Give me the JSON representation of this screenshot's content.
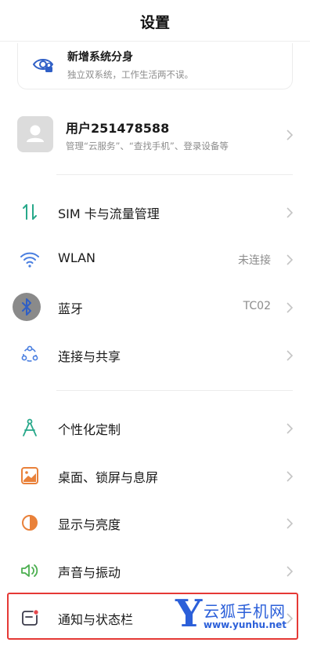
{
  "header": {
    "title": "设置"
  },
  "promo": {
    "title": "新增系统分身",
    "subtitle": "独立双系统，工作生活两不误。",
    "icon": "eye-lock-icon"
  },
  "account": {
    "name": "用户251478588",
    "description": "管理“云服务”、“查找手机”、登录设备等"
  },
  "settings": {
    "group1": [
      {
        "label": "SIM 卡与流量管理",
        "value": "",
        "icon": "sim-data-icon",
        "color": "#27a88a"
      },
      {
        "label": "WLAN",
        "value": "未连接",
        "icon": "wifi-icon",
        "color": "#4a7fe0"
      },
      {
        "label": "蓝牙",
        "value": "TC02",
        "icon": "bluetooth-icon",
        "color": "#3f68c8"
      },
      {
        "label": "连接与共享",
        "value": "",
        "icon": "connection-share-icon",
        "color": "#4a7fe0"
      }
    ],
    "group2": [
      {
        "label": "个性化定制",
        "value": "",
        "icon": "personalize-icon",
        "color": "#27a88a"
      },
      {
        "label": "桌面、锁屏与息屏",
        "value": "",
        "icon": "wallpaper-icon",
        "color": "#e9813a"
      },
      {
        "label": "显示与亮度",
        "value": "",
        "icon": "display-brightness-icon",
        "color": "#e9813a"
      },
      {
        "label": "声音与振动",
        "value": "",
        "icon": "sound-vibration-icon",
        "color": "#4caf50"
      },
      {
        "label": "通知与状态栏",
        "value": "",
        "icon": "notification-icon",
        "color": "#e5484d"
      }
    ]
  },
  "watermark": {
    "letter": "Y",
    "name": "云狐手机网",
    "url": "www.yunhu.net"
  },
  "colors": {
    "highlight": "#e53935",
    "watermark": "#2b5fd9",
    "chevron": "#c4c4c4"
  }
}
